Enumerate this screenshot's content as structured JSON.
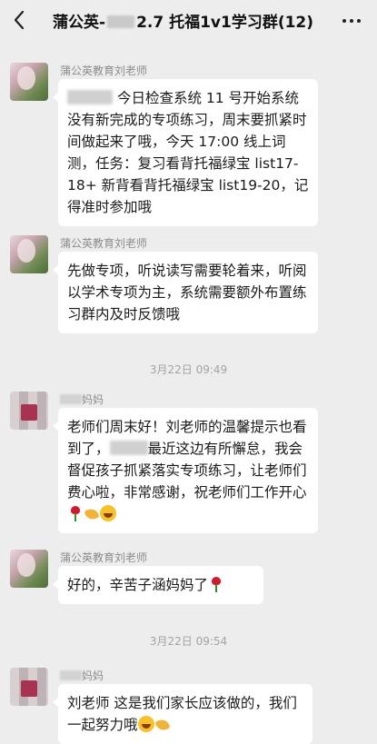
{
  "header": {
    "title_prefix": "蒲公英-",
    "title_suffix": "2.7 托福1v1学习群(12)",
    "back_icon": "chevron-left-icon",
    "more_icon": "more-dots-icon"
  },
  "messages": [
    {
      "sender": "蒲公英教育刘老师",
      "text": "今日检查系统 11 号开始系统没有新完成的专项练习，周末要抓紧时间做起来了哦，今天 17:00 线上词测，任务：复习看背托福绿宝 list17-18+ 新背看背托福绿宝 list19-20，记得准时参加哦"
    },
    {
      "sender": "蒲公英教育刘老师",
      "text": "先做专项，听说读写需要轮着来，听阅以学术专项为主，系统需要额外布置练习群内及时反馈哦"
    },
    {
      "time": "3月22日 09:49"
    },
    {
      "sender": "妈妈",
      "text_part1": "老师们周末好！刘老师的温馨提示也看到了，",
      "text_part2": "最近这边有所懈怠，我会督促孩子抓紧落实专项练习，让老师们费心啦，非常感谢，祝老师们工作开心"
    },
    {
      "sender": "蒲公英教育刘老师",
      "text": "好的，辛苦子涵妈妈了"
    },
    {
      "time": "3月22日 09:54"
    },
    {
      "sender": "妈妈",
      "text": "刘老师 这是我们家长应该做的，我们一起努力哦"
    }
  ]
}
